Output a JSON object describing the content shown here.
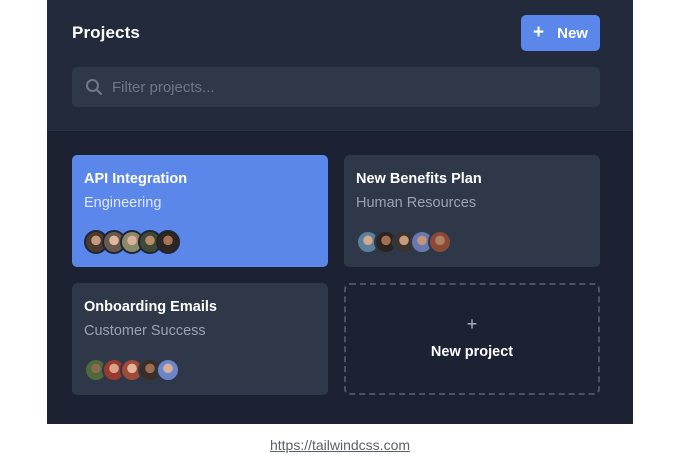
{
  "header": {
    "title": "Projects",
    "new_button": {
      "icon": "plus-icon",
      "label": "New"
    }
  },
  "search": {
    "placeholder": "Filter projects...",
    "value": "",
    "icon": "search-icon"
  },
  "projects": [
    {
      "name": "API Integration",
      "team": "Engineering",
      "active": true,
      "member_count": 5
    },
    {
      "name": "New Benefits Plan",
      "team": "Human Resources",
      "active": false,
      "member_count": 5
    },
    {
      "name": "Onboarding Emails",
      "team": "Customer Success",
      "active": false,
      "member_count": 5
    }
  ],
  "add_card": {
    "icon": "plus-icon",
    "label": "New project"
  },
  "footer": {
    "url": "https://tailwindcss.com"
  },
  "colors": {
    "panel_bg": "#1c2231",
    "header_bg": "#222a3b",
    "card_bg": "#2f3848",
    "accent": "#5b87ea",
    "text_primary": "#ffffff",
    "text_muted": "#9aa3b2"
  }
}
